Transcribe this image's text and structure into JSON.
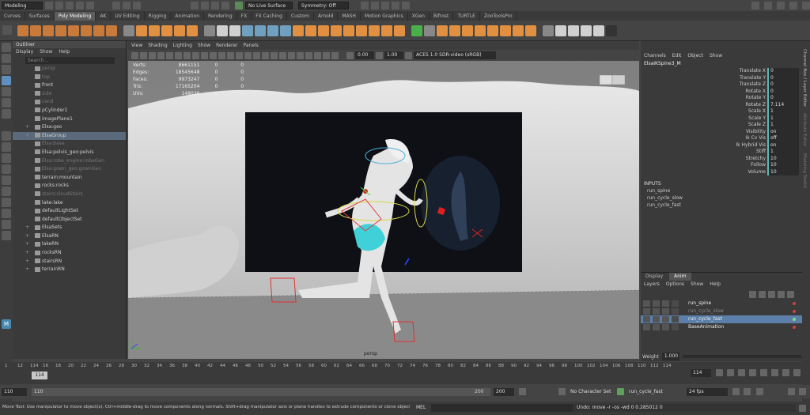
{
  "topbar": {
    "mode": "Modeling",
    "symmetry": "Symmetry: Off",
    "live_surface": "No Live Surface"
  },
  "shelf_tabs": [
    "Curves",
    "Surfaces",
    "Poly Modeling",
    "AK",
    "UV Editing",
    "Rigging",
    "Animation",
    "Rendering",
    "FX",
    "FX Caching",
    "Custom",
    "Arnold",
    "MASH",
    "Motion Graphics",
    "XGen",
    "Bifrost",
    "TURTLE",
    "ZooToolsPro"
  ],
  "active_tab": "Poly Modeling",
  "outliner": {
    "title": "Outliner",
    "menu": [
      "Display",
      "Show",
      "Help"
    ],
    "search_placeholder": "Search...",
    "items": [
      {
        "label": "persp",
        "dim": true
      },
      {
        "label": "top",
        "dim": true
      },
      {
        "label": "front",
        "dim": false
      },
      {
        "label": "side",
        "dim": true
      },
      {
        "label": "cand",
        "dim": true
      },
      {
        "label": "pCylinder1",
        "dim": false
      },
      {
        "label": "imagePlane1",
        "dim": false
      },
      {
        "label": "Elsa:geo",
        "dim": false,
        "exp": "+"
      },
      {
        "label": "ElsaGroup",
        "dim": false,
        "exp": "+",
        "sel": true
      },
      {
        "label": "Elsa:base",
        "dim": true
      },
      {
        "label": "Elsa:pelvis_geo:pelvis",
        "dim": false
      },
      {
        "label": "Elsa:robe_engine:robeGen",
        "dim": true
      },
      {
        "label": "Elsa:gown_geo:gownGen",
        "dim": true
      },
      {
        "label": "terrain:mountain",
        "dim": false
      },
      {
        "label": "rocks:rocks",
        "dim": false
      },
      {
        "label": "stairs:cloudStairs",
        "dim": true
      },
      {
        "label": "lake:lake",
        "dim": false
      },
      {
        "label": "defaultLightSet",
        "dim": false
      },
      {
        "label": "defaultObjectSet",
        "dim": false
      },
      {
        "label": "ElsaSets",
        "dim": false,
        "exp": "+"
      },
      {
        "label": "ElsaRN",
        "dim": false,
        "exp": "+"
      },
      {
        "label": "lakeRN",
        "dim": false,
        "exp": "+"
      },
      {
        "label": "rocksRN",
        "dim": false,
        "exp": "+"
      },
      {
        "label": "stairsRN",
        "dim": false,
        "exp": "+"
      },
      {
        "label": "terrainRN",
        "dim": false,
        "exp": "+"
      }
    ]
  },
  "viewport": {
    "menu": [
      "View",
      "Shading",
      "Lighting",
      "Show",
      "Renderer",
      "Panels"
    ],
    "exposure": "0.00",
    "gamma": "1.00",
    "colorspace": "ACES 1.0 SDR-video (sRGB)",
    "hud": [
      {
        "k": "Verts:",
        "a": "8661151",
        "b": "0",
        "c": "0"
      },
      {
        "k": "Edges:",
        "a": "18545648",
        "b": "0",
        "c": "0"
      },
      {
        "k": "Faces:",
        "a": "9973247",
        "b": "0",
        "c": "0"
      },
      {
        "k": "Tris:",
        "a": "17165204",
        "b": "0",
        "c": "0"
      },
      {
        "k": "UVs:",
        "a": "148036",
        "b": "0",
        "c": "0"
      }
    ],
    "camera_label": "persp"
  },
  "channel_box": {
    "menu": [
      "Channels",
      "Edit",
      "Object",
      "Show"
    ],
    "node": "ElsaIKSpine3_M",
    "attrs": [
      {
        "n": "Translate X",
        "v": "0"
      },
      {
        "n": "Translate Y",
        "v": "0"
      },
      {
        "n": "Translate Z",
        "v": "0"
      },
      {
        "n": "Rotate X",
        "v": "0"
      },
      {
        "n": "Rotate Y",
        "v": "0"
      },
      {
        "n": "Rotate Z",
        "v": "7.114"
      },
      {
        "n": "Scale X",
        "v": "1"
      },
      {
        "n": "Scale Y",
        "v": "1"
      },
      {
        "n": "Scale Z",
        "v": "1"
      },
      {
        "n": "Visibility",
        "v": "on"
      },
      {
        "n": "Ik Cv Vis",
        "v": "off"
      },
      {
        "n": "Ik Hybrid Vis",
        "v": "on"
      },
      {
        "n": "Stiff",
        "v": "1"
      },
      {
        "n": "Stretchy",
        "v": "10"
      },
      {
        "n": "Follow",
        "v": "10"
      },
      {
        "n": "Volume",
        "v": "10"
      }
    ],
    "inputs_label": "INPUTS",
    "inputs": [
      "run_spine",
      "run_cycle_slow",
      "run_cycle_fast"
    ]
  },
  "layers": {
    "tabs": [
      "Display",
      "Anim"
    ],
    "menu": [
      "Layers",
      "Options",
      "Show",
      "Help"
    ],
    "rows": [
      {
        "label": "run_spine",
        "sel": false
      },
      {
        "label": "run_cycle_slow",
        "sel": false,
        "dim": true
      },
      {
        "label": "run_cycle_fast",
        "sel": true
      },
      {
        "label": "BaseAnimation",
        "sel": false
      }
    ],
    "weight_label": "Weight",
    "weight": "1.000"
  },
  "timeline": {
    "ticks": [
      "1",
      "12",
      "114",
      "16",
      "18",
      "20",
      "22",
      "24",
      "26",
      "28",
      "30",
      "32",
      "34",
      "36",
      "38",
      "40",
      "42",
      "44",
      "46",
      "48",
      "50",
      "52",
      "54",
      "56",
      "58",
      "60",
      "62",
      "64",
      "66",
      "68",
      "70",
      "72",
      "74",
      "76",
      "78",
      "80",
      "82",
      "84",
      "86",
      "88",
      "90",
      "92",
      "94",
      "96",
      "98",
      "100",
      "102",
      "104",
      "106",
      "108",
      "110",
      "112",
      "114"
    ],
    "current": "114"
  },
  "range": {
    "start": "110",
    "start2": "110",
    "end": "200",
    "end2": "200",
    "char_set": "No Character Set",
    "anim_layer": "run_cycle_fast",
    "fps": "24 fps"
  },
  "cmd": {
    "help": "Move Tool: Use manipulator to move object(s). Ctrl+middle-drag to move components along normals. Shift+drag manipulator axis or plane handles to extrude components or clone objects. Ctrl+Shift+drag to constr",
    "lang": "MEL",
    "result": "Undo: move -r -os -wd 0 0.285012 0"
  }
}
